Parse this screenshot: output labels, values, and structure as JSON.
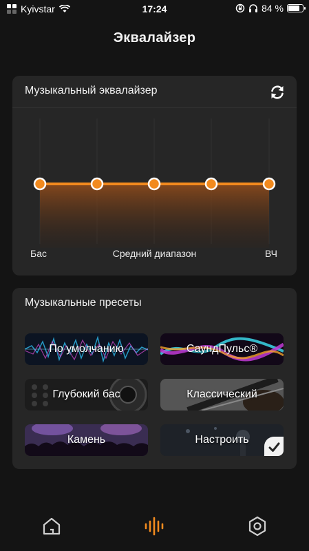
{
  "status_bar": {
    "carrier": "Kyivstar",
    "time": "17:24",
    "battery": "84 %",
    "icons": [
      "signal-icon",
      "wifi-icon",
      "rotation-lock-icon",
      "headphones-icon",
      "battery-icon"
    ]
  },
  "header": {
    "title": "Эквалайзер"
  },
  "equalizer": {
    "title": "Музыкальный эквалайзер",
    "reset_icon": "refresh-icon",
    "band_levels": [
      0,
      0,
      0,
      0,
      0
    ],
    "labels": {
      "bass": "Бас",
      "mid": "Средний диапазон",
      "treble": "ВЧ"
    },
    "accent_color": "#f28a1e"
  },
  "presets": {
    "title": "Музыкальные пресеты",
    "items": [
      {
        "label": "По умолчанию"
      },
      {
        "label": "СаундПульс®"
      },
      {
        "label": "Глубокий бас"
      },
      {
        "label": "Классический"
      },
      {
        "label": "Камень"
      },
      {
        "label": "Настроить",
        "selected": true
      }
    ]
  },
  "bottom_nav": {
    "items": [
      "home-icon",
      "equalizer-icon",
      "settings-icon"
    ],
    "active": "equalizer-icon",
    "active_color": "#f28a1e"
  }
}
